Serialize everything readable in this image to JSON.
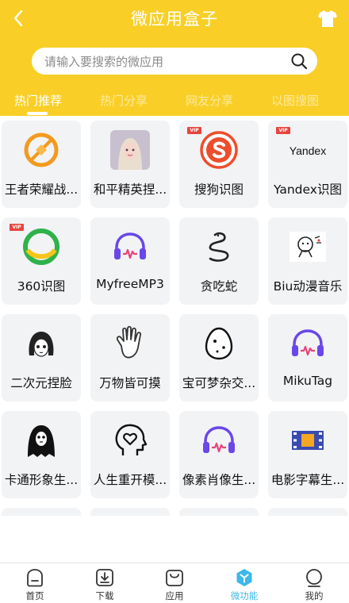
{
  "header": {
    "title": "微应用盒子",
    "search_placeholder": "请输入要搜索的微应用",
    "tabs": [
      "热门推荐",
      "热门分享",
      "网友分享",
      "以图搜图"
    ],
    "active_tab": 0
  },
  "vip_badge": "VIP",
  "apps": [
    {
      "label": "王者荣耀战...",
      "icon": "honor-of-kings-icon",
      "vip": false
    },
    {
      "label": "和平精英捏...",
      "icon": "peace-elite-avatar-icon",
      "vip": false
    },
    {
      "label": "搜狗识图",
      "icon": "sogou-icon",
      "vip": true
    },
    {
      "label": "Yandex识图",
      "icon": "yandex-icon",
      "vip": true
    },
    {
      "label": "360识图",
      "icon": "360-icon",
      "vip": true
    },
    {
      "label": "MyfreeMP3",
      "icon": "headphones-icon",
      "vip": false
    },
    {
      "label": "贪吃蛇",
      "icon": "snake-icon",
      "vip": false
    },
    {
      "label": "Biu动漫音乐",
      "icon": "anime-doodle-icon",
      "vip": false
    },
    {
      "label": "二次元捏脸",
      "icon": "anime-face-icon",
      "vip": false
    },
    {
      "label": "万物皆可摸",
      "icon": "hand-icon",
      "vip": false
    },
    {
      "label": "宝可梦杂交...",
      "icon": "egg-icon",
      "vip": false
    },
    {
      "label": "MikuTag",
      "icon": "headphones-icon",
      "vip": false
    },
    {
      "label": "卡通形象生...",
      "icon": "ghost-icon",
      "vip": false
    },
    {
      "label": "人生重开模...",
      "icon": "head-heart-icon",
      "vip": false
    },
    {
      "label": "像素肖像生...",
      "icon": "headphones-icon",
      "vip": false
    },
    {
      "label": "电影字幕生...",
      "icon": "film-strip-icon",
      "vip": false
    }
  ],
  "bottom_nav": [
    {
      "label": "首页",
      "icon": "home-icon"
    },
    {
      "label": "下载",
      "icon": "download-icon"
    },
    {
      "label": "应用",
      "icon": "apps-bag-icon"
    },
    {
      "label": "微功能",
      "icon": "micro-function-icon"
    },
    {
      "label": "我的",
      "icon": "profile-icon"
    }
  ],
  "active_nav": 3,
  "colors": {
    "header": "#f9cf27",
    "accent": "#3db8e8",
    "card": "#f2f3f5"
  }
}
